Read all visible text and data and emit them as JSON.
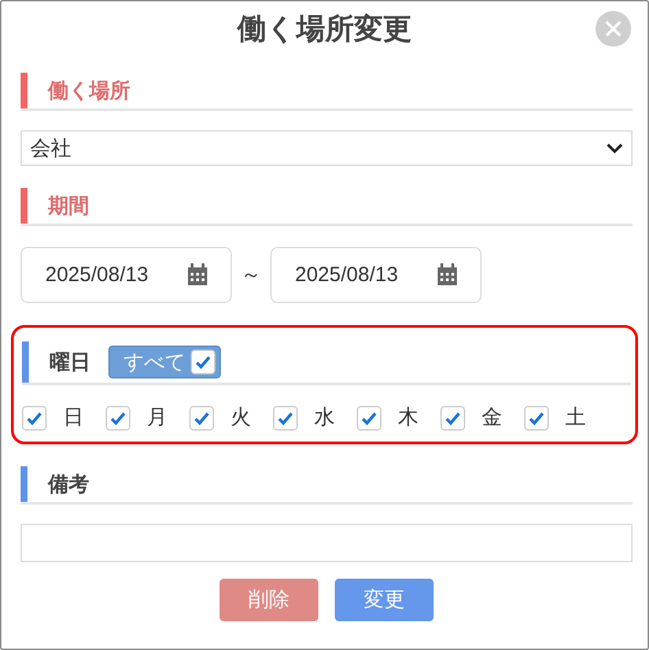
{
  "dialog": {
    "title": "働く場所変更"
  },
  "work_place": {
    "heading": {
      "label": "働く場所",
      "kind": "required"
    },
    "select": {
      "value": "会社"
    }
  },
  "period": {
    "heading": {
      "label": "期間",
      "kind": "required"
    },
    "start_date": {
      "value": "2025/08/13"
    },
    "separator": "～",
    "end_date": {
      "value": "2025/08/13"
    }
  },
  "weekdays": {
    "heading": {
      "label": "曜日",
      "kind": "optional"
    },
    "highlighted": true,
    "all_toggle": {
      "label": "すべて",
      "checked": true
    },
    "days": [
      {
        "label": "日",
        "checked": true
      },
      {
        "label": "月",
        "checked": true
      },
      {
        "label": "火",
        "checked": true
      },
      {
        "label": "水",
        "checked": true
      },
      {
        "label": "木",
        "checked": true
      },
      {
        "label": "金",
        "checked": true
      },
      {
        "label": "土",
        "checked": true
      }
    ]
  },
  "remarks": {
    "heading": {
      "label": "備考",
      "kind": "optional"
    }
  },
  "buttons": [
    {
      "label": "削除",
      "kind": "delete"
    },
    {
      "label": "変更",
      "kind": "submit"
    }
  ]
}
